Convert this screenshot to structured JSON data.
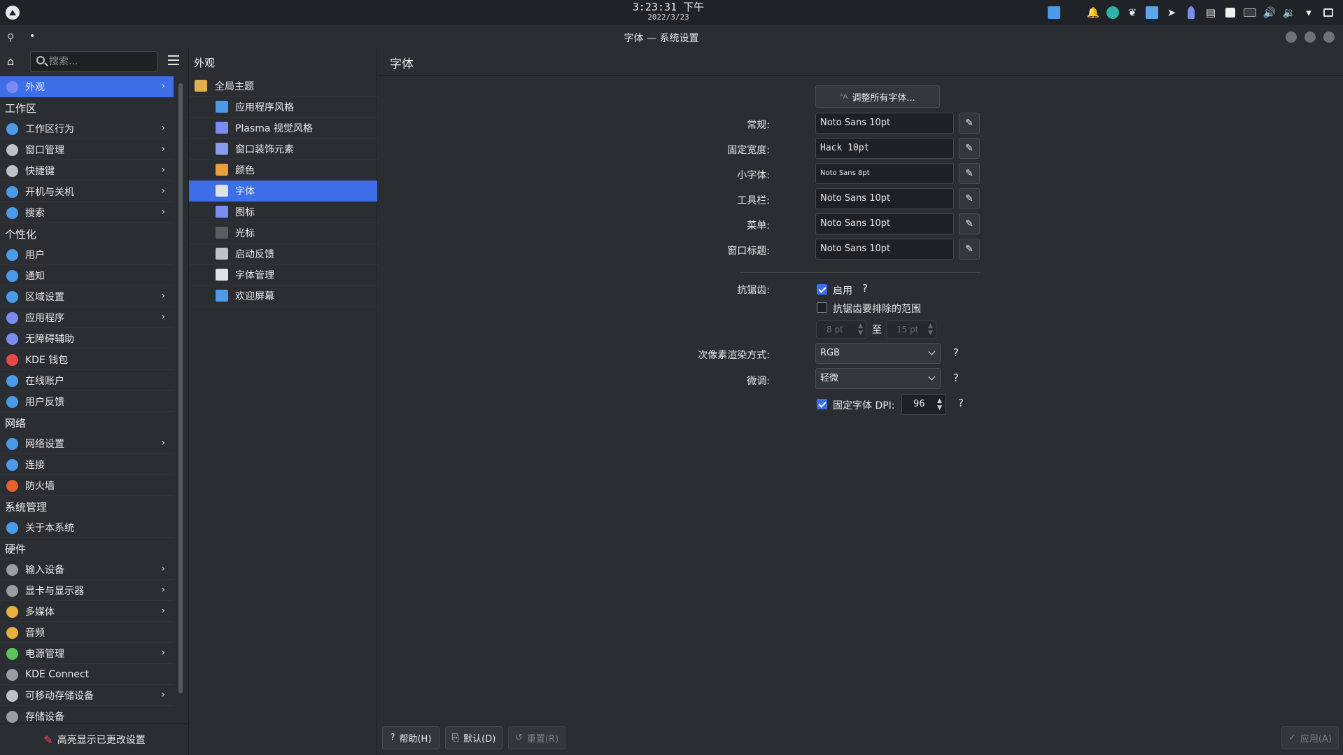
{
  "panel": {
    "time": "3:23:31 下午",
    "date": "2022/3/23"
  },
  "window": {
    "title": "字体 — 系统设置"
  },
  "sidebar": {
    "search_placeholder": "搜索...",
    "items": [
      {
        "type": "item",
        "label": "外观",
        "icon": "appearance-icon",
        "color": "#7b8cf0",
        "chevron": true,
        "active": true
      },
      {
        "type": "category",
        "label": "工作区"
      },
      {
        "type": "item",
        "label": "工作区行为",
        "icon": "workspace-icon",
        "color": "#4b9be8",
        "chevron": true
      },
      {
        "type": "item",
        "label": "窗口管理",
        "icon": "window-icon",
        "color": "#bfc3c8",
        "chevron": true
      },
      {
        "type": "item",
        "label": "快捷键",
        "icon": "keyboard-icon",
        "color": "#bfc3c8",
        "chevron": true
      },
      {
        "type": "item",
        "label": "开机与关机",
        "icon": "power-icon",
        "color": "#4b9be8",
        "chevron": true
      },
      {
        "type": "item",
        "label": "搜索",
        "icon": "search-icon",
        "color": "#4b9be8",
        "chevron": true
      },
      {
        "type": "category",
        "label": "个性化"
      },
      {
        "type": "item",
        "label": "用户",
        "icon": "user-icon",
        "color": "#4b9be8"
      },
      {
        "type": "item",
        "label": "通知",
        "icon": "notification-icon",
        "color": "#4b9be8"
      },
      {
        "type": "item",
        "label": "区域设置",
        "icon": "locale-icon",
        "color": "#4b9be8",
        "chevron": true
      },
      {
        "type": "item",
        "label": "应用程序",
        "icon": "applications-icon",
        "color": "#7b8cf0",
        "chevron": true
      },
      {
        "type": "item",
        "label": "无障碍辅助",
        "icon": "accessibility-icon",
        "color": "#7b8cf0"
      },
      {
        "type": "item",
        "label": "KDE 钱包",
        "icon": "wallet-icon",
        "color": "#e84a4a"
      },
      {
        "type": "item",
        "label": "在线账户",
        "icon": "online-accounts-icon",
        "color": "#4b9be8"
      },
      {
        "type": "item",
        "label": "用户反馈",
        "icon": "feedback-icon",
        "color": "#4b9be8"
      },
      {
        "type": "category",
        "label": "网络"
      },
      {
        "type": "item",
        "label": "网络设置",
        "icon": "network-settings-icon",
        "color": "#4b9be8",
        "chevron": true
      },
      {
        "type": "item",
        "label": "连接",
        "icon": "connection-icon",
        "color": "#4b9be8"
      },
      {
        "type": "item",
        "label": "防火墙",
        "icon": "firewall-icon",
        "color": "#e8602c"
      },
      {
        "type": "category",
        "label": "系统管理"
      },
      {
        "type": "item",
        "label": "关于本系统",
        "icon": "info-icon",
        "color": "#4b9be8"
      },
      {
        "type": "category",
        "label": "硬件"
      },
      {
        "type": "item",
        "label": "输入设备",
        "icon": "mouse-icon",
        "color": "#9a9ea3",
        "chevron": true
      },
      {
        "type": "item",
        "label": "显卡与显示器",
        "icon": "display-icon",
        "color": "#9a9ea3",
        "chevron": true
      },
      {
        "type": "item",
        "label": "多媒体",
        "icon": "multimedia-icon",
        "color": "#e8b03c",
        "chevron": true
      },
      {
        "type": "item",
        "label": "音频",
        "icon": "audio-icon",
        "color": "#e8b03c"
      },
      {
        "type": "item",
        "label": "电源管理",
        "icon": "battery-icon",
        "color": "#5cc45c",
        "chevron": true
      },
      {
        "type": "item",
        "label": "KDE Connect",
        "icon": "phone-icon",
        "color": "#9a9ea3"
      },
      {
        "type": "item",
        "label": "可移动存储设备",
        "icon": "removable-storage-icon",
        "color": "#bfc3c8",
        "chevron": true
      },
      {
        "type": "item",
        "label": "存储设备",
        "icon": "storage-icon",
        "color": "#9a9ea3"
      }
    ],
    "footer_label": "高亮显示已更改设置"
  },
  "middle": {
    "title": "外观",
    "items": [
      {
        "label": "全局主题",
        "icon": "global-theme-icon",
        "color": "#e0b050",
        "top": true
      },
      {
        "label": "应用程序风格",
        "icon": "app-style-icon",
        "color": "#4b9be8"
      },
      {
        "label": "Plasma 视觉风格",
        "icon": "plasma-style-icon",
        "color": "#7b8cf0"
      },
      {
        "label": "窗口装饰元素",
        "icon": "window-decoration-icon",
        "color": "#8a9cf0"
      },
      {
        "label": "颜色",
        "icon": "color-icon",
        "color": "#e8a03c"
      },
      {
        "label": "字体",
        "icon": "font-icon",
        "color": "#dfe2e6",
        "active": true
      },
      {
        "label": "图标",
        "icon": "icons-icon",
        "color": "#7b8cf0"
      },
      {
        "label": "光标",
        "icon": "cursor-icon",
        "color": "#5a5e63"
      },
      {
        "label": "启动反馈",
        "icon": "launch-feedback-icon",
        "color": "#bfc3c8"
      },
      {
        "label": "字体管理",
        "icon": "font-management-icon",
        "color": "#dfe2e6"
      },
      {
        "label": "欢迎屏幕",
        "icon": "splash-screen-icon",
        "color": "#4b9be8"
      }
    ]
  },
  "main": {
    "title": "字体",
    "adjust_all_label": "调整所有字体...",
    "fonts": [
      {
        "label": "常规:",
        "value": "Noto Sans 10pt",
        "style": ""
      },
      {
        "label": "固定宽度:",
        "value": "Hack 10pt",
        "style": "mono"
      },
      {
        "label": "小字体:",
        "value": "Noto Sans 8pt",
        "style": "small"
      },
      {
        "label": "工具栏:",
        "value": "Noto Sans 10pt",
        "style": ""
      },
      {
        "label": "菜单:",
        "value": "Noto Sans 10pt",
        "style": ""
      },
      {
        "label": "窗口标题:",
        "value": "Noto Sans 10pt",
        "style": ""
      }
    ],
    "antialias_label": "抗锯齿:",
    "antialias_enable_label": "启用",
    "antialias_enabled": true,
    "exclude_range_label": "抗锯齿要排除的范围",
    "exclude_range_checked": false,
    "range_from": "8 pt",
    "range_to_label": "至",
    "range_to": "15 pt",
    "subpixel_label": "次像素渲染方式:",
    "subpixel_value": "RGB",
    "hinting_label": "微调:",
    "hinting_value": "轻微",
    "fixed_dpi_label": "固定字体 DPI:",
    "fixed_dpi_checked": true,
    "dpi_value": "96",
    "help_mark": "?"
  },
  "buttons": {
    "help": "帮助(H)",
    "defaults": "默认(D)",
    "reset": "重置(R)",
    "apply": "应用(A)"
  },
  "colors": {
    "accent": "#3d6ee8",
    "background": "#2a2e32",
    "panel": "#1f2226"
  }
}
